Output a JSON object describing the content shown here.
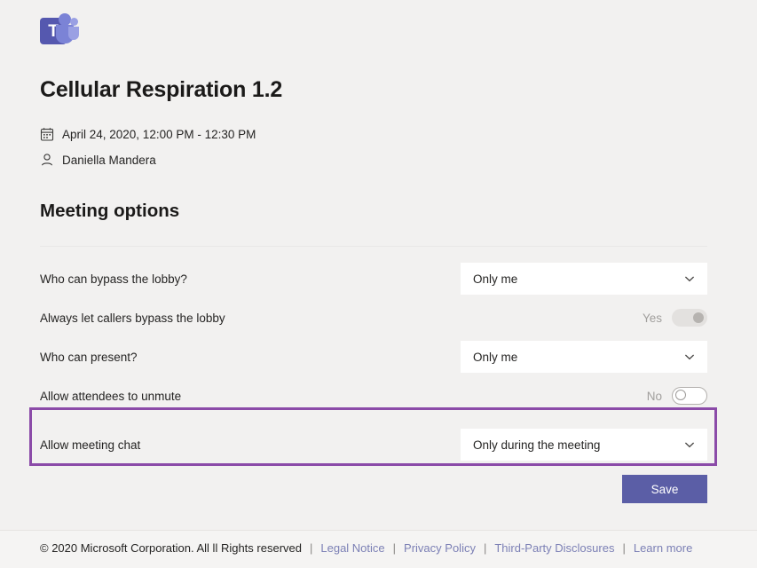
{
  "brand": {
    "logo_icon": "microsoft-teams-logo",
    "logo_letter": "T",
    "accent_color": "#5b5ea6",
    "highlight_color": "#8b4ba8"
  },
  "meeting": {
    "title": "Cellular Respiration 1.2",
    "date_icon": "calendar-icon",
    "date_text": "April 24, 2020, 12:00 PM - 12:30 PM",
    "organizer_icon": "person-icon",
    "organizer_name": "Daniella Mandera"
  },
  "options_section": {
    "heading": "Meeting options",
    "rows": [
      {
        "label": "Who can bypass the lobby?",
        "control": "dropdown",
        "value": "Only me",
        "chevron_icon": "chevron-down-icon"
      },
      {
        "label": "Always let callers bypass the lobby",
        "control": "toggle",
        "state_label": "Yes",
        "state": "on"
      },
      {
        "label": "Who can present?",
        "control": "dropdown",
        "value": "Only me",
        "chevron_icon": "chevron-down-icon"
      },
      {
        "label": "Allow attendees to unmute",
        "control": "toggle",
        "state_label": "No",
        "state": "off"
      },
      {
        "label": "Allow meeting chat",
        "control": "dropdown",
        "value": "Only during the meeting",
        "chevron_icon": "chevron-down-icon",
        "highlighted": true
      }
    ]
  },
  "actions": {
    "save_label": "Save"
  },
  "footer": {
    "copyright": "© 2020 Microsoft Corporation. All ll Rights reserved",
    "separator": "|",
    "links": [
      "Legal Notice",
      "Privacy Policy",
      "Third-Party Disclosures",
      "Learn more"
    ]
  }
}
